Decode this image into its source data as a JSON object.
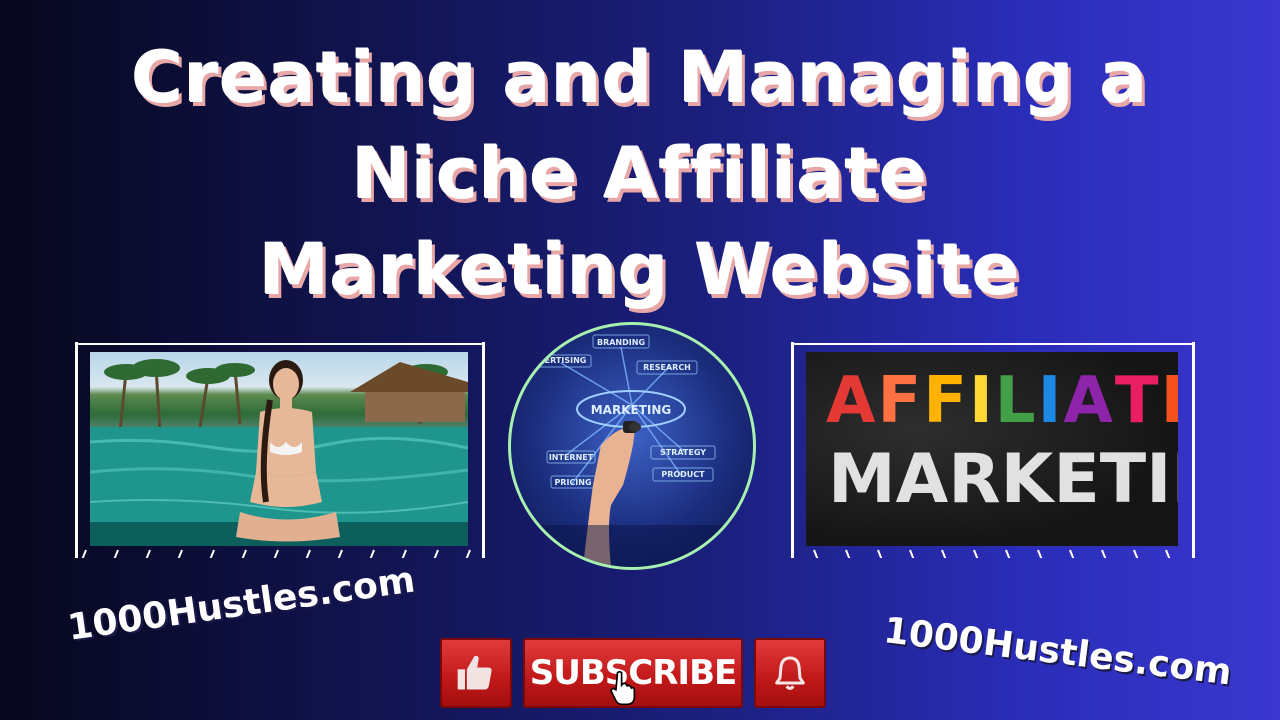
{
  "title": {
    "line1": "Creating and Managing a",
    "line2": "Niche Affiliate",
    "line3": "Marketing Website"
  },
  "center_image": {
    "center_label": "MARKETING",
    "labels": [
      "BRANDING",
      "ADVERTISING",
      "RESEARCH",
      "INTERNET",
      "PRICING",
      "STRATEGY",
      "PRODUCT"
    ]
  },
  "chalkboard": {
    "letters": [
      "A",
      "F",
      "F",
      "I",
      "L",
      "I",
      "A",
      "T",
      "E"
    ],
    "letter_colors": [
      "#e53935",
      "#ff7043",
      "#ffb300",
      "#fdd835",
      "#43a047",
      "#1e88e5",
      "#8e24aa",
      "#e91e63",
      "#f4511e"
    ],
    "word2": "MARKETING"
  },
  "domain_left": "1000Hustles.com",
  "domain_right": "1000Hustles.com",
  "buttons": {
    "subscribe": "SUBSCRIBE"
  },
  "colors": {
    "accent_red": "#c01818",
    "title_shadow": "#e8a7a7",
    "circle_border": "#a8f0b0"
  }
}
